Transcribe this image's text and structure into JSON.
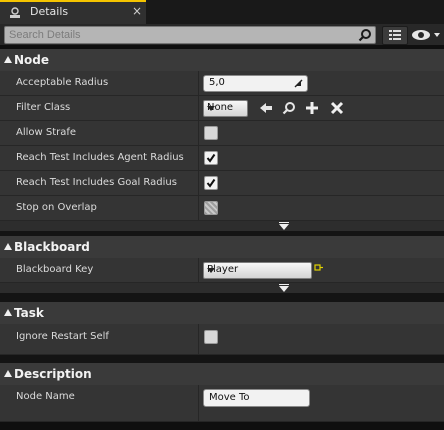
{
  "tab": {
    "title": "Details",
    "close": "×"
  },
  "search": {
    "placeholder": "Search Details"
  },
  "sections": {
    "node": {
      "title": "Node",
      "acceptable_radius": {
        "label": "Acceptable Radius",
        "value": "5,0"
      },
      "filter_class": {
        "label": "Filter Class",
        "value": "None"
      },
      "allow_strafe": {
        "label": "Allow Strafe",
        "checked": false
      },
      "reach_agent": {
        "label": "Reach Test Includes Agent Radius",
        "checked": true
      },
      "reach_goal": {
        "label": "Reach Test Includes Goal Radius",
        "checked": true
      },
      "stop_overlap": {
        "label": "Stop on Overlap",
        "checked": false
      }
    },
    "blackboard": {
      "title": "Blackboard",
      "key": {
        "label": "Blackboard Key",
        "value": "Player"
      }
    },
    "task": {
      "title": "Task",
      "ignore_restart": {
        "label": "Ignore Restart Self",
        "checked": false
      }
    },
    "description": {
      "title": "Description",
      "node_name": {
        "label": "Node Name",
        "value": "Move To"
      }
    }
  },
  "colors": {
    "tab_accent": "#f5c400",
    "row_bg": "#343434",
    "header_bg": "#3a3a3a"
  },
  "icons": [
    "details-tab-icon",
    "search-icon",
    "grid-view-icon",
    "eye-icon",
    "use-selected-arrow-icon",
    "browse-icon",
    "add-icon",
    "clear-icon",
    "resize-icon",
    "key-icon"
  ]
}
